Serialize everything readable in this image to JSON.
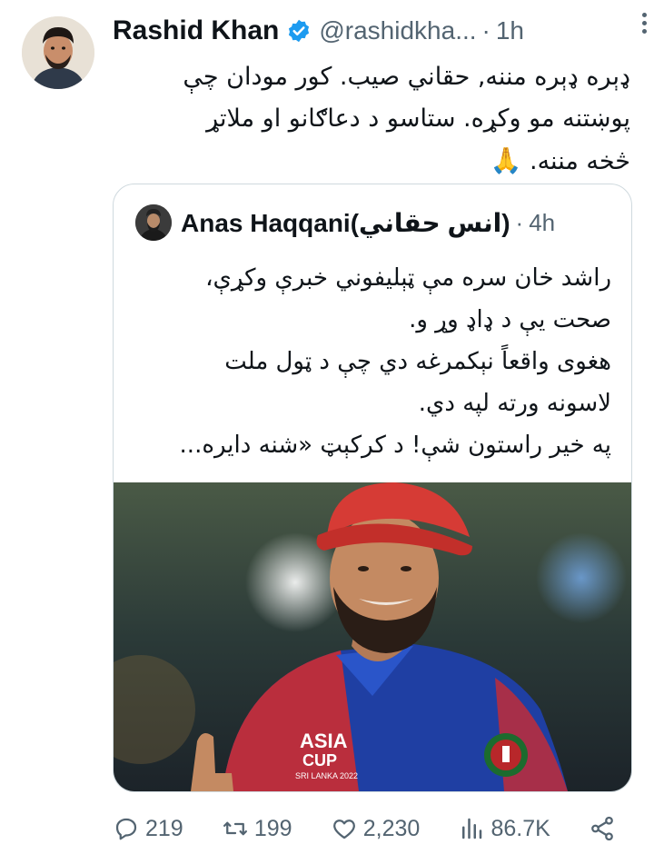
{
  "tweet": {
    "author": {
      "name": "Rashid Khan",
      "handle": "@rashidkha...",
      "avatar_icon": "profile-photo"
    },
    "time": "1h",
    "separator": "·",
    "text_lines": [
      "ډېره ډېره مننه, حقاني صيب. کور مودان چې",
      "پوښتنه مو وکړه. ستاسو د دعاګانو او ملاتړ",
      "څخه مننه."
    ],
    "emoji": "🙏",
    "quoted": {
      "author_name": "Anas Haqqani(انس حقاني)",
      "time": "4h",
      "separator": "·",
      "text_lines": [
        "راشد خان سره مې ټېليفوني خبرې وکړې،",
        "صحت يې د ډاډ وړ و.",
        "هغوی واقعاً نېکمرغه دي چې د ټول ملت",
        "لاسونه ورته لپه دي.",
        "په خير راستون شې! د کرکېټ «شنه دايره..."
      ],
      "image_text": {
        "jersey_title": "ASIA",
        "jersey_subtitle": "CUP",
        "jersey_small": "SRI LANKA 2022"
      }
    },
    "stats": {
      "replies": "219",
      "retweets": "199",
      "likes": "2,230",
      "views": "86.7K"
    }
  },
  "colors": {
    "text": "#0f1419",
    "muted": "#536471",
    "verified": "#1d9bf0",
    "border": "#cfd9de"
  }
}
